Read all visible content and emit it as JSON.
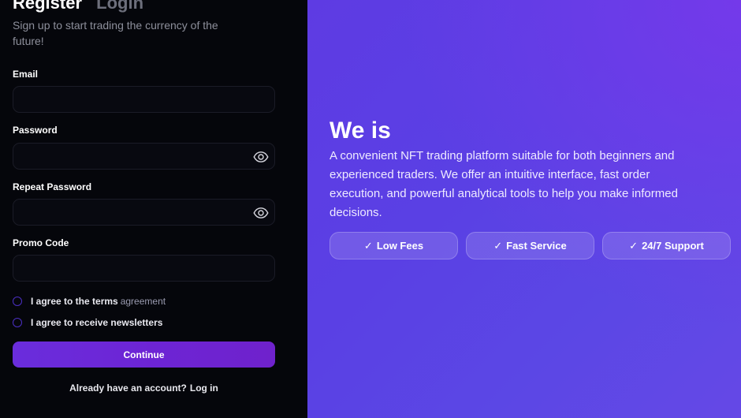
{
  "auth": {
    "tabs": [
      {
        "label": "Register",
        "active": true
      },
      {
        "label": "Login",
        "active": false
      }
    ],
    "subtitle": "Sign up to start trading the currency of the future!"
  },
  "form": {
    "email": {
      "label": "Email",
      "value": ""
    },
    "password": {
      "label": "Password",
      "value": "",
      "icon": "eye-icon"
    },
    "repeat_password": {
      "label": "Repeat Password",
      "value": "",
      "icon": "eye-icon"
    },
    "promo_code": {
      "label": "Promo Code",
      "value": ""
    },
    "terms": {
      "label": "I agree to the terms",
      "link": "agreement",
      "checked": false
    },
    "newsletters": {
      "label": "I agree to receive newsletters",
      "checked": false
    },
    "continue_label": "Continue",
    "login_prompt": "Already have an account?",
    "login_link": "Log in"
  },
  "hero": {
    "title": "We is",
    "description": "A convenient NFT trading platform suitable for both beginners and experienced traders. We offer an intuitive interface, fast order execution, and powerful analytical tools to help you make informed decisions.",
    "features": [
      {
        "icon": "✓",
        "label": "Low Fees"
      },
      {
        "icon": "✓",
        "label": "Fast Service"
      },
      {
        "icon": "✓",
        "label": "24/7 Support"
      }
    ]
  },
  "colors": {
    "accent": "#6a2ddc",
    "left_background": "#05060b",
    "hero_gradient_start": "#5e3be3",
    "hero_gradient_end": "#7439ea",
    "checkbox_border": "#4b2fc2"
  }
}
